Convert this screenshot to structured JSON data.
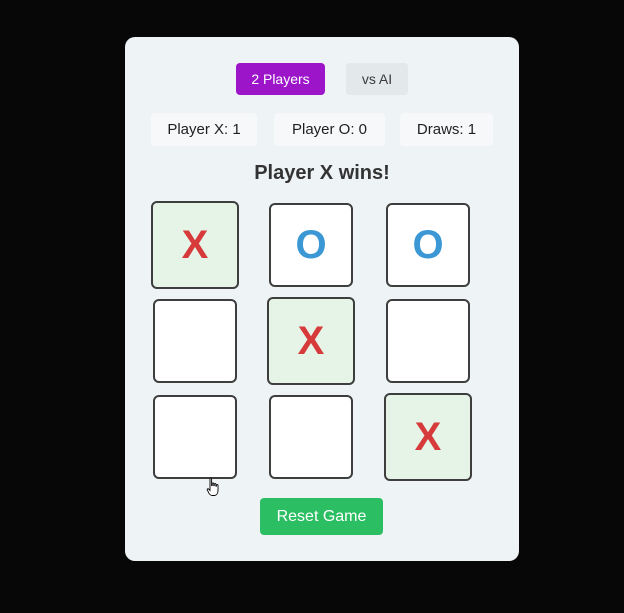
{
  "modes": {
    "two_players": "2 Players",
    "vs_ai": "vs AI",
    "selected": "2 Players"
  },
  "scores": {
    "x": "Player X: 1",
    "o": "Player O: 0",
    "draws": "Draws: 1"
  },
  "status": "Player X wins!",
  "board": [
    "X",
    "O",
    "O",
    "",
    "X",
    "",
    "",
    "",
    "X"
  ],
  "winning_cells": [
    0,
    4,
    8
  ],
  "reset_label": "Reset Game",
  "colors": {
    "x_mark": "#d63a3a",
    "o_mark": "#3b98d5",
    "active_mode": "#9c15c9",
    "reset": "#2cbe62",
    "win_cell": "#e6f4e8"
  },
  "icons": {
    "cursor": "hand-pointer-icon"
  }
}
